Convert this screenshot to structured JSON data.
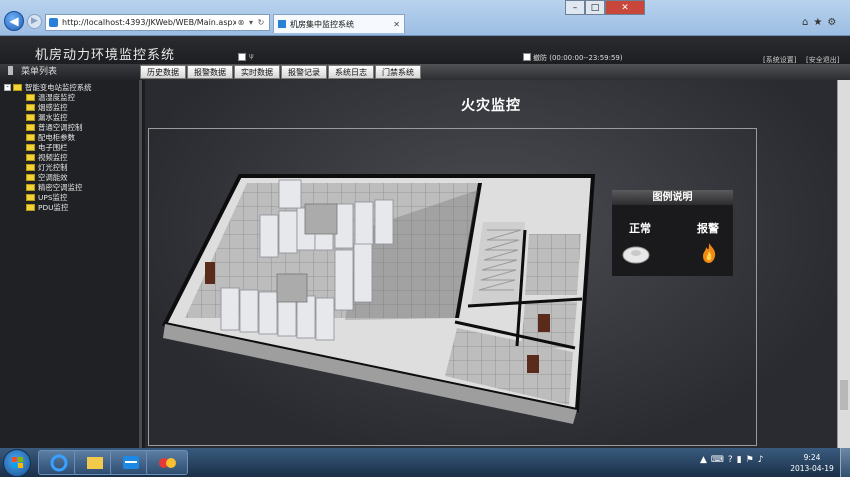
{
  "browser": {
    "address": "http://localhost:4393/JKWeb/WEB/Main.aspx",
    "tab_title": "机房集中监控系统",
    "addr_controls": [
      "⊗",
      "▾",
      "↻"
    ]
  },
  "header": {
    "title": "机房动力环境监控系统",
    "checkbox_label": "ψ",
    "guard_label": "撤防 (00:00:00--23:59:59)",
    "settings_link": "[系统设置]",
    "logout_link": "[安全退出]"
  },
  "menu": {
    "head": "菜单列表",
    "buttons": [
      "历史数据",
      "报警数据",
      "实时数据",
      "报警记录",
      "系统日志",
      "门禁系统"
    ]
  },
  "tree": {
    "root": "智能变电站监控系统",
    "items": [
      "温湿度监控",
      "烟感监控",
      "漏水监控",
      "普通空调控制",
      "配电柜参数",
      "电子围栏",
      "视频监控",
      "灯光控制",
      "空调能效",
      "精密空调监控",
      "UPS监控",
      "PDU监控"
    ]
  },
  "main": {
    "page_title": "火灾监控",
    "legend": {
      "title": "图例说明",
      "normal": "正常",
      "alarm": "报警"
    }
  },
  "taskbar": {
    "time": "9:24",
    "date": "2013-04-19"
  },
  "colors": {
    "accent": "#2a7fd6",
    "alarm": "#f08a14",
    "folder": "#f2d43a"
  }
}
